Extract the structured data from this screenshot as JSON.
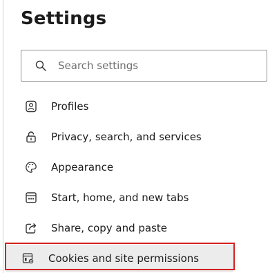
{
  "title": "Settings",
  "search": {
    "placeholder": "Search settings",
    "icon": "search-icon"
  },
  "nav": {
    "items": [
      {
        "label": "Profiles",
        "icon": "profile-icon"
      },
      {
        "label": "Privacy, search, and services",
        "icon": "lock-icon"
      },
      {
        "label": "Appearance",
        "icon": "palette-icon"
      },
      {
        "label": "Start, home, and new tabs",
        "icon": "start-page-icon"
      },
      {
        "label": "Share, copy and paste",
        "icon": "share-icon"
      },
      {
        "label": "Cookies and site permissions",
        "icon": "site-permissions-icon",
        "selected": true
      }
    ]
  },
  "colors": {
    "accent": "#0f6cbd",
    "highlight_border": "#d42020",
    "selected_background": "#ececec"
  }
}
